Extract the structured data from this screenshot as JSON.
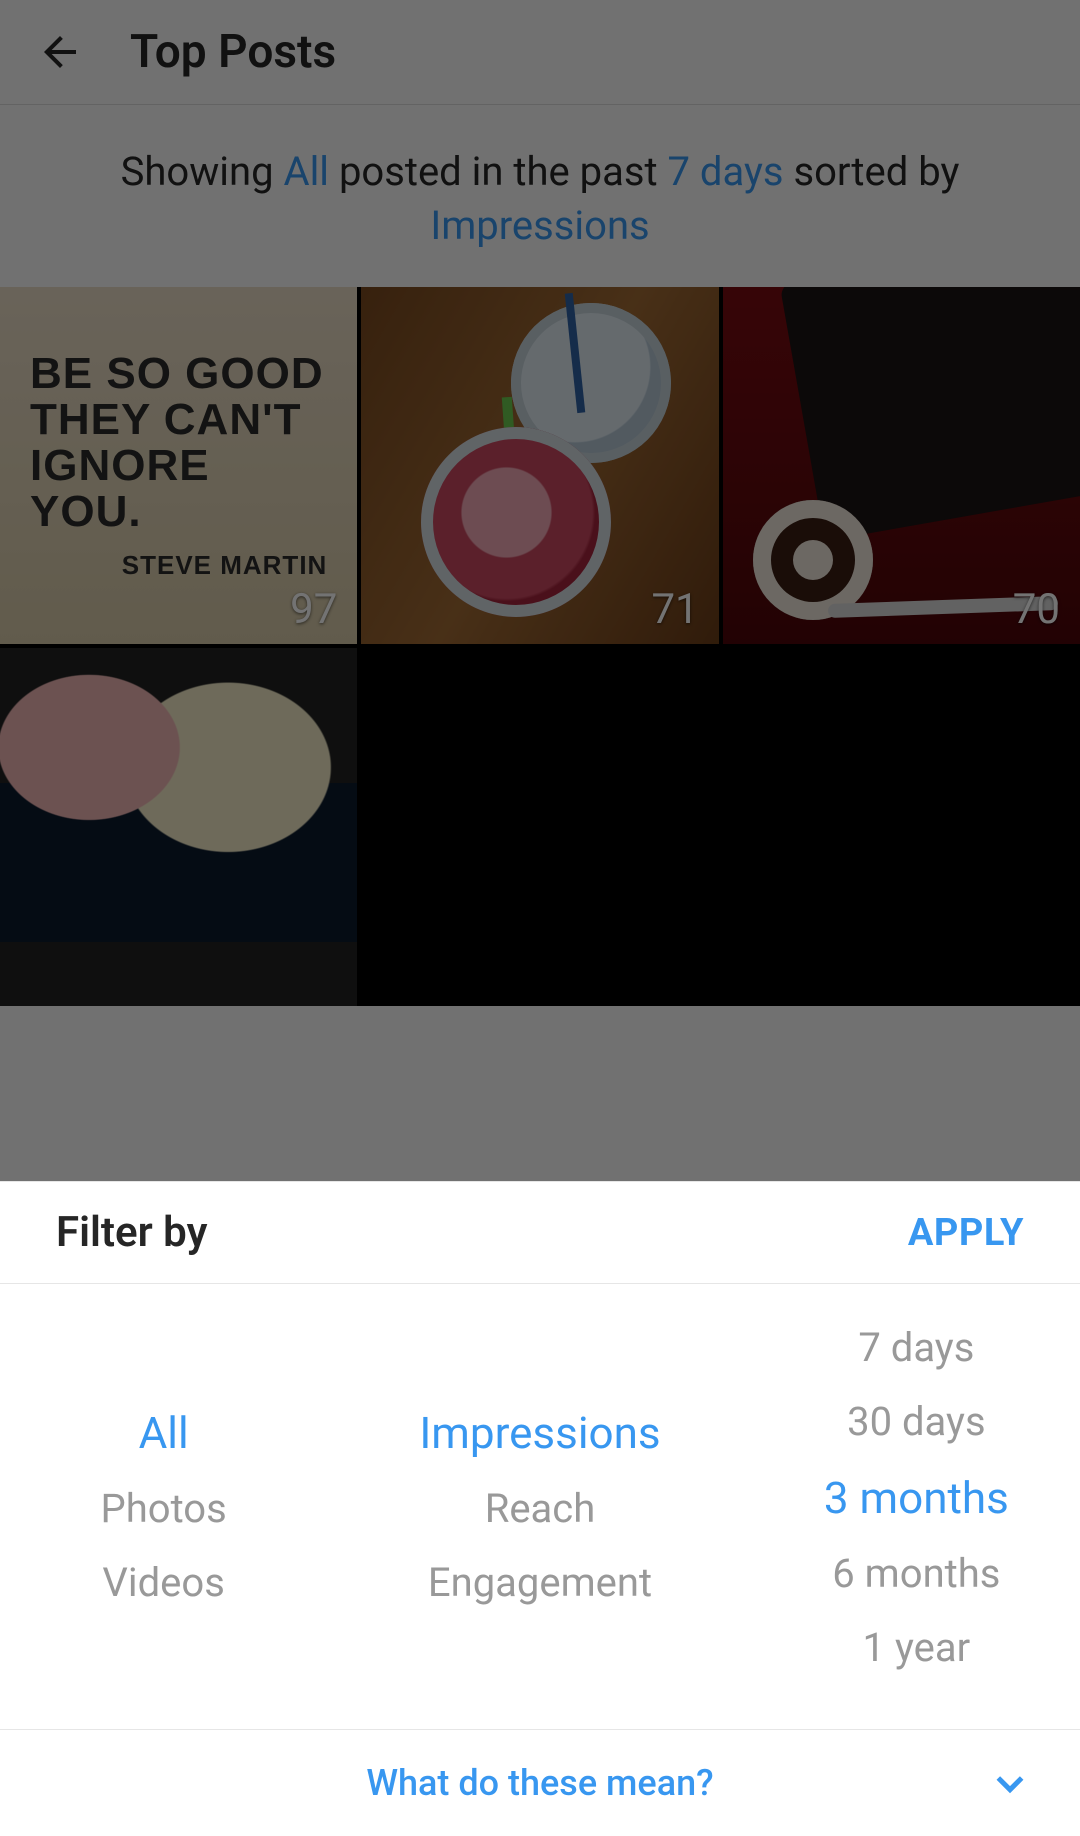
{
  "header": {
    "title": "Top Posts"
  },
  "summary": {
    "prefix": "Showing ",
    "type": "All",
    "mid1": " posted in the past ",
    "period": "7 days",
    "mid2": " sorted by ",
    "metric": "Impressions"
  },
  "posts": [
    {
      "count": "97",
      "quote": "BE SO GOOD THEY CAN'T IGNORE YOU.",
      "attribution": "STEVE MARTIN"
    },
    {
      "count": "71"
    },
    {
      "count": "70"
    },
    {
      "count": ""
    }
  ],
  "sheet": {
    "title": "Filter by",
    "apply_label": "APPLY",
    "type_options": [
      "All",
      "Photos",
      "Videos"
    ],
    "metric_options": [
      "Impressions",
      "Reach",
      "Engagement"
    ],
    "period_options": [
      "7 days",
      "30 days",
      "3 months",
      "6 months",
      "1 year"
    ],
    "selected": {
      "type": "All",
      "metric": "Impressions",
      "period": "3 months"
    },
    "help_label": "What do these mean?"
  }
}
